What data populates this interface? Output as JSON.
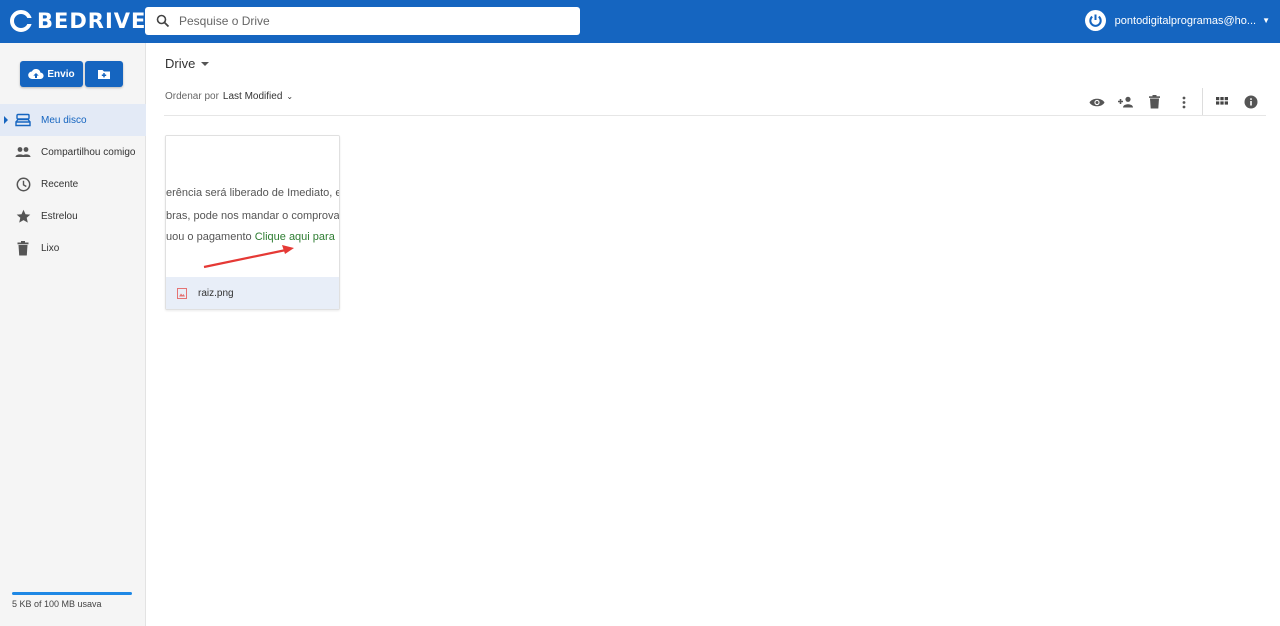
{
  "app": {
    "logo_text": "BEDRIVE"
  },
  "search": {
    "placeholder": "Pesquise o Drive"
  },
  "account": {
    "email": "pontodigitalprogramas@ho..."
  },
  "sidebar": {
    "upload_label": "Envio",
    "items": [
      {
        "label": "Meu disco",
        "icon": "drive-icon",
        "active": true
      },
      {
        "label": "Compartilhou comigo",
        "icon": "people-icon",
        "active": false
      },
      {
        "label": "Recente",
        "icon": "clock-icon",
        "active": false
      },
      {
        "label": "Estrelou",
        "icon": "star-icon",
        "active": false
      },
      {
        "label": "Lixo",
        "icon": "trash-icon",
        "active": false
      }
    ],
    "storage": {
      "text": "5 KB of 100 MB usava",
      "used_fraction": 5e-05
    }
  },
  "main": {
    "breadcrumb": "Drive",
    "sort": {
      "label": "Ordenar por",
      "value": "Last Modified"
    },
    "toolbar_icons": [
      "preview-icon",
      "share-user-icon",
      "delete-icon",
      "more-vert-icon",
      "grid-view-icon",
      "info-icon"
    ],
    "files": [
      {
        "name": "raiz.png",
        "thumbnail_lines": [
          "erência será liberado de Imediato, e",
          "bras, pode nos mandar o comprova",
          "uou o pagamento",
          "Clique aqui para"
        ]
      }
    ]
  },
  "colors": {
    "brand": "#1565c0",
    "active_bg": "#e3eaf6",
    "link_green": "#2e7d32"
  }
}
